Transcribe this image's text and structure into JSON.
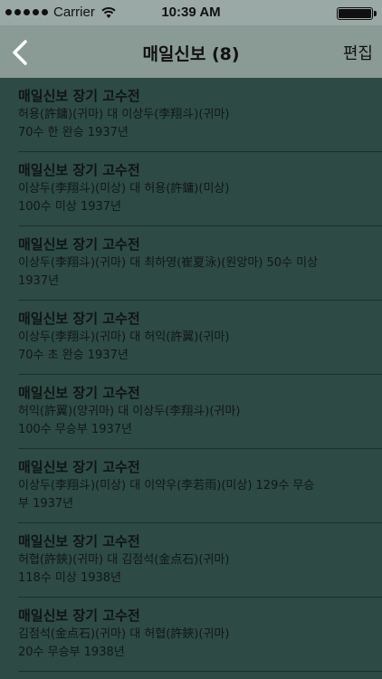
{
  "status_bar": {
    "carrier": "Carrier",
    "time": "10:39 AM"
  },
  "nav": {
    "title": "매일신보 (8)",
    "edit_label": "편집"
  },
  "items": [
    {
      "title": "매일신보 장기 고수전",
      "line1": "허용(許鏞)(귀마) 대 이상두(李翔斗)(귀마)",
      "line2": "70수 한 완승 1937년"
    },
    {
      "title": "매일신보 장기 고수전",
      "line1": "이상두(李翔斗)(미상) 대 허용(許鏞)(미상)",
      "line2": "100수 미상 1937년"
    },
    {
      "title": "매일신보 장기 고수전",
      "line1": "이상두(李翔斗)(귀마) 대 최하영(崔夏泳)(원앙마) 50수 미상",
      "line2": "1937년"
    },
    {
      "title": "매일신보 장기 고수전",
      "line1": "이상두(李翔斗)(귀마) 대 허익(許翼)(귀마)",
      "line2": "70수 초 완승 1937년"
    },
    {
      "title": "매일신보 장기 고수전",
      "line1": "허익(許翼)(양귀마) 대 이상두(李翔斗)(귀마)",
      "line2": "100수 무승부 1937년"
    },
    {
      "title": "매일신보 장기 고수전",
      "line1": "이상두(李翔斗)(미상) 대 이약우(李若雨)(미상) 129수 무승",
      "line2": "부 1937년"
    },
    {
      "title": "매일신보 장기 고수전",
      "line1": "허협(許鋏)(귀마) 대 김점석(金点石)(귀마)",
      "line2": "118수 미상 1938년"
    },
    {
      "title": "매일신보 장기 고수전",
      "line1": "김점석(金点石)(귀마) 대 허협(許鋏)(귀마)",
      "line2": "20수 무승부 1938년"
    }
  ]
}
